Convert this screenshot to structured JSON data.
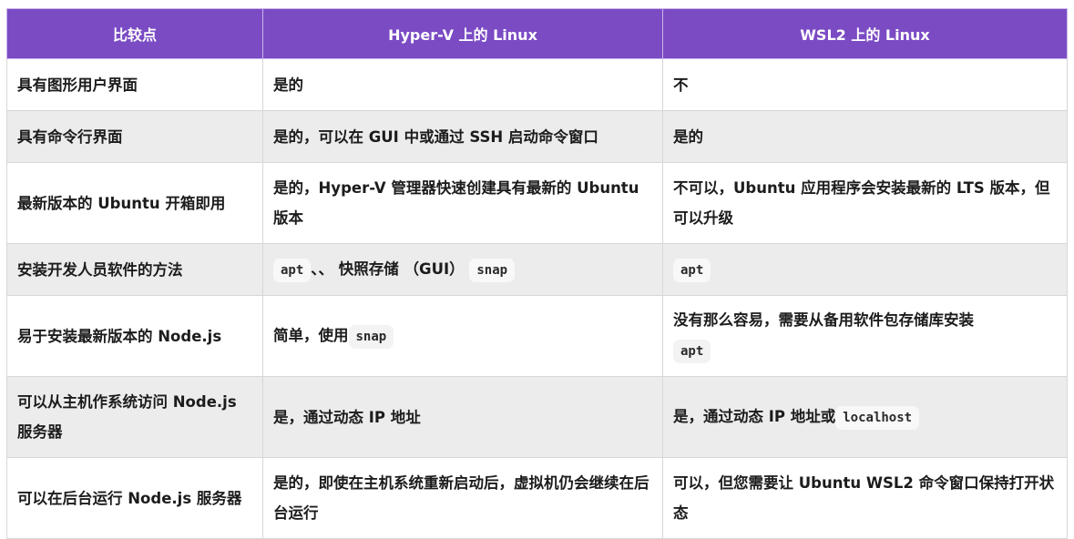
{
  "table": {
    "headers": [
      "比较点",
      "Hyper-V 上的 Linux",
      "WSL2 上的 Linux"
    ],
    "rows": [
      {
        "point": "具有图形用户界面",
        "hyperv": "是的",
        "wsl2": "不"
      },
      {
        "point": "具有命令行界面",
        "hyperv": "是的，可以在 GUI 中或通过 SSH 启动命令窗口",
        "wsl2": "是的"
      },
      {
        "point": "最新版本的 Ubuntu 开箱即用",
        "hyperv": "是的，Hyper-V 管理器快速创建具有最新的 Ubuntu 版本",
        "wsl2": "不可以，Ubuntu 应用程序会安装最新的 LTS 版本，但可以升级"
      },
      {
        "point": "安装开发人员软件的方法",
        "hyperv_code1": "apt",
        "hyperv_mid": "、、 快照存储 （GUI）",
        "hyperv_code2": "snap",
        "wsl2_code": "apt"
      },
      {
        "point": "易于安装最新版本的 Node.js",
        "hyperv_text": "简单，使用",
        "hyperv_code": "snap",
        "wsl2_text": "没有那么容易，需要从备用软件包存储库安装",
        "wsl2_code": "apt"
      },
      {
        "point": "可以从主机作系统访问 Node.js 服务器",
        "hyperv": "是，通过动态 IP 地址",
        "wsl2_text": "是，通过动态 IP 地址或",
        "wsl2_code": "localhost"
      },
      {
        "point": "可以在后台运行 Node.js 服务器",
        "hyperv": "是的，即使在主机系统重新启动后，虚拟机仍会继续在后台运行",
        "wsl2": "可以，但您需要让 Ubuntu WSL2 命令窗口保持打开状态"
      }
    ]
  }
}
